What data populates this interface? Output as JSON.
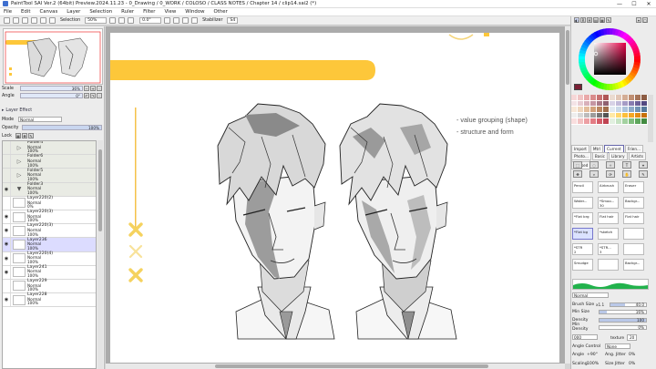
{
  "window": {
    "title": "PaintTool SAI Ver.2 (64bit) Preview.2024.11.23 - 0_Drawing / 0_WORK / COLOSO / CLASS NOTES / Chapter 14 / clip14.sai2 (*)",
    "minimize": "—",
    "maximize": "☐",
    "close": "✕"
  },
  "menu": [
    "File",
    "Edit",
    "Canvas",
    "Layer",
    "Selection",
    "Ruler",
    "Filter",
    "View",
    "Window",
    "Other"
  ],
  "toolbar": {
    "selection_label": "Selection",
    "zoom": "50%",
    "rotation": "0.0°",
    "stabilizer_label": "Stabilizer",
    "stabilizer_value": "S4"
  },
  "navigator": {
    "scale_label": "Scale",
    "scale_value": "36%",
    "angle_label": "Angle",
    "angle_value": "0°"
  },
  "layer_panel": {
    "effect_label": "Layer Effect",
    "mode_label": "Mode",
    "mode_value": "Normal",
    "opacity_label": "Opacity",
    "opacity_value": "100%",
    "opacity_fraction": 1.0,
    "lock_label": "Lock",
    "clipping_label": "Clipping Group",
    "selection_source_label": "Selection Source",
    "layers": [
      {
        "name": "Folder4",
        "mode": "Normal",
        "opacity": "100%",
        "type": "folder",
        "visible": false,
        "selected": false
      },
      {
        "name": "Folder6",
        "mode": "Normal",
        "opacity": "100%",
        "type": "folder",
        "visible": false,
        "selected": false
      },
      {
        "name": "Folder5",
        "mode": "Normal",
        "opacity": "100%",
        "type": "folder",
        "visible": false,
        "selected": false
      },
      {
        "name": "Folder3",
        "mode": "Normal",
        "opacity": "100%",
        "type": "folder-open",
        "visible": true,
        "selected": false
      },
      {
        "name": "Layer220(2)",
        "mode": "Normal",
        "opacity": "0%",
        "type": "layer",
        "visible": false,
        "selected": false
      },
      {
        "name": "Layer220(3)",
        "mode": "Normal",
        "opacity": "100%",
        "type": "layer",
        "visible": true,
        "selected": false
      },
      {
        "name": "Layer220(3)",
        "mode": "Normal",
        "opacity": "100%",
        "type": "layer",
        "visible": true,
        "selected": false
      },
      {
        "name": "Layer236",
        "mode": "Normal",
        "opacity": "100%",
        "type": "layer",
        "visible": true,
        "selected": true
      },
      {
        "name": "Layer220(4)",
        "mode": "Normal",
        "opacity": "100%",
        "type": "layer",
        "visible": true,
        "selected": false
      },
      {
        "name": "Layer241",
        "mode": "Normal",
        "opacity": "100%",
        "type": "layer",
        "visible": true,
        "selected": false
      },
      {
        "name": "Layer229",
        "mode": "Normal",
        "opacity": "100%",
        "type": "layer",
        "visible": false,
        "selected": false
      },
      {
        "name": "Layer228",
        "mode": "Normal",
        "opacity": "100%",
        "type": "layer",
        "visible": true,
        "selected": false
      }
    ]
  },
  "canvas": {
    "notes": [
      "- value grouping (shape)",
      "- structure and form"
    ],
    "accent_color": "#fdc73a"
  },
  "color_panel": {
    "selected_color": "#7a1f35"
  },
  "swatches": [
    "#f6d7d7",
    "#f0c4c4",
    "#e9a9a9",
    "#d98b8b",
    "#c87171",
    "#b05656",
    "#eadbd0",
    "#e1c6b5",
    "#d3ad95",
    "#c08f73",
    "#a67459",
    "#8c5c43",
    "#f3e3e6",
    "#e8cdd3",
    "#d8b0ba",
    "#c595a2",
    "#aa7a88",
    "#8f6170",
    "#d7d2e6",
    "#c2bad9",
    "#a59bc5",
    "#887db0",
    "#6d6198",
    "#534981",
    "#f8e8d8",
    "#efd6bd",
    "#e3bd9b",
    "#d2a17b",
    "#bb8762",
    "#a06e4c",
    "#e1e9f2",
    "#c9d8e8",
    "#adc3db",
    "#8eabc9",
    "#7192b4",
    "#56799c",
    "#eeeeee",
    "#d8d8d8",
    "#bcbcbc",
    "#9c9c9c",
    "#777777",
    "#555555",
    "#ffe9a6",
    "#ffd66b",
    "#fcbf3a",
    "#f5a623",
    "#e38c14",
    "#c7700a",
    "#f9dede",
    "#f2c2c2",
    "#ec9fa3",
    "#e37c84",
    "#d45d69",
    "#bf4352",
    "#e2f0e0",
    "#c6e3c3",
    "#a3d1a0",
    "#7fbd7c",
    "#5ea65c",
    "#428b41"
  ],
  "tabs_row1": [
    "Import",
    "Mtrl",
    "Current",
    "Frien...",
    "Texture"
  ],
  "tabs_row2": [
    "Photo...",
    "Basic",
    "Library",
    "Artists",
    "unused"
  ],
  "active_tab": "Current",
  "tools": [
    {
      "name": "Pencil",
      "value": "",
      "selected": false
    },
    {
      "name": "Airbrush",
      "value": "",
      "selected": false
    },
    {
      "name": "Eraser",
      "value": "",
      "selected": false
    },
    {
      "name": "Water...",
      "value": "",
      "selected": false
    },
    {
      "name": "*Smoo...",
      "value": "30",
      "selected": false
    },
    {
      "name": "Backgr...",
      "value": "",
      "selected": false
    },
    {
      "name": "*Flat brg",
      "value": "",
      "selected": false
    },
    {
      "name": "Flat hair",
      "value": "",
      "selected": false
    },
    {
      "name": "Flat hair",
      "value": "",
      "selected": false
    },
    {
      "name": "*Flat bg",
      "value": "",
      "selected": true
    },
    {
      "name": "*sketch",
      "value": "",
      "selected": false
    },
    {
      "name": "",
      "value": "",
      "selected": false
    },
    {
      "name": "*STR",
      "value": "2",
      "selected": false
    },
    {
      "name": "*STR...",
      "value": "3",
      "selected": false
    },
    {
      "name": "",
      "value": "",
      "selected": false
    },
    {
      "name": "Smudge",
      "value": "",
      "selected": false
    },
    {
      "name": "",
      "value": "",
      "selected": false
    },
    {
      "name": "Backgr...",
      "value": "",
      "selected": false
    }
  ],
  "brush": {
    "mode_value": "Normal",
    "brush_size_label": "Brush Size",
    "brush_size_value": "40.0",
    "brush_size_mult": "x1.1",
    "min_size_label": "Min Size",
    "min_size_value": "16%",
    "min_size_fraction": 0.16,
    "density_label": "Density",
    "density_value": "100",
    "density_fraction": 1.0,
    "min_density_label": "Min Density",
    "min_density_value": "0%",
    "min_density_fraction": 0.0,
    "texture_value": "000",
    "texture_detail": "texture",
    "texture_amount": "20",
    "angle_control_label": "Angle Control",
    "angle_control_value": "None",
    "angle_label": "Angle",
    "angle_value": "+90°",
    "ang_jitter_label": "Ang. Jitter",
    "ang_jitter_value": "0%",
    "scaling_label": "Scaling",
    "scaling_value": "100%",
    "size_jitter_label": "Size Jitter",
    "size_jitter_value": "0%"
  }
}
